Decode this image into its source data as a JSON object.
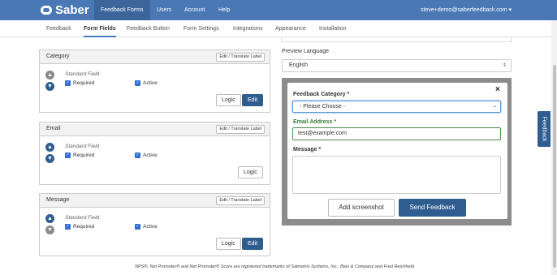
{
  "app": {
    "logo_text": "Saber"
  },
  "topnav": {
    "items": [
      "Feedback Forms",
      "Users",
      "Account",
      "Help"
    ],
    "user_menu": "steve+demo@saberfeedback.com"
  },
  "subnav": {
    "items": [
      "Feedback",
      "Form Fields",
      "Feedback Button",
      "Form Settings",
      "Integrations",
      "Appearance",
      "Installation"
    ]
  },
  "fields": [
    {
      "title": "Category",
      "translate": "Edit / Translate Label",
      "type": "Standard Field",
      "required": "Required",
      "active": "Active",
      "logic": "Logic",
      "edit": "Edit"
    },
    {
      "title": "Email",
      "translate": "Edit / Translate Label",
      "type": "Standard Field",
      "required": "Required",
      "active": "Active",
      "logic": "Logic"
    },
    {
      "title": "Message",
      "translate": "Edit / Translate Label",
      "type": "Standard Field",
      "required": "Required",
      "active": "Active",
      "logic": "Logic",
      "edit": "Edit"
    }
  ],
  "preview": {
    "language_label": "Preview Language",
    "language_value": "English",
    "close": "×",
    "category_label": "Feedback Category *",
    "category_value": "- Please Choose -",
    "email_label": "Email Address *",
    "email_value": "test@example.com",
    "message_label": "Message *",
    "screenshot_button": "Add screenshot",
    "send_button": "Send Feedback"
  },
  "feedback_tab": "Feedback",
  "footer": "NPS®, Net Promoter® and Net Promoter® Score are registered trademarks of Satmetrix Systems, Inc., Bain & Company and Fred Reichheld",
  "colors": {
    "brand": "#4a78b5",
    "primary_button": "#2f5d8f"
  }
}
